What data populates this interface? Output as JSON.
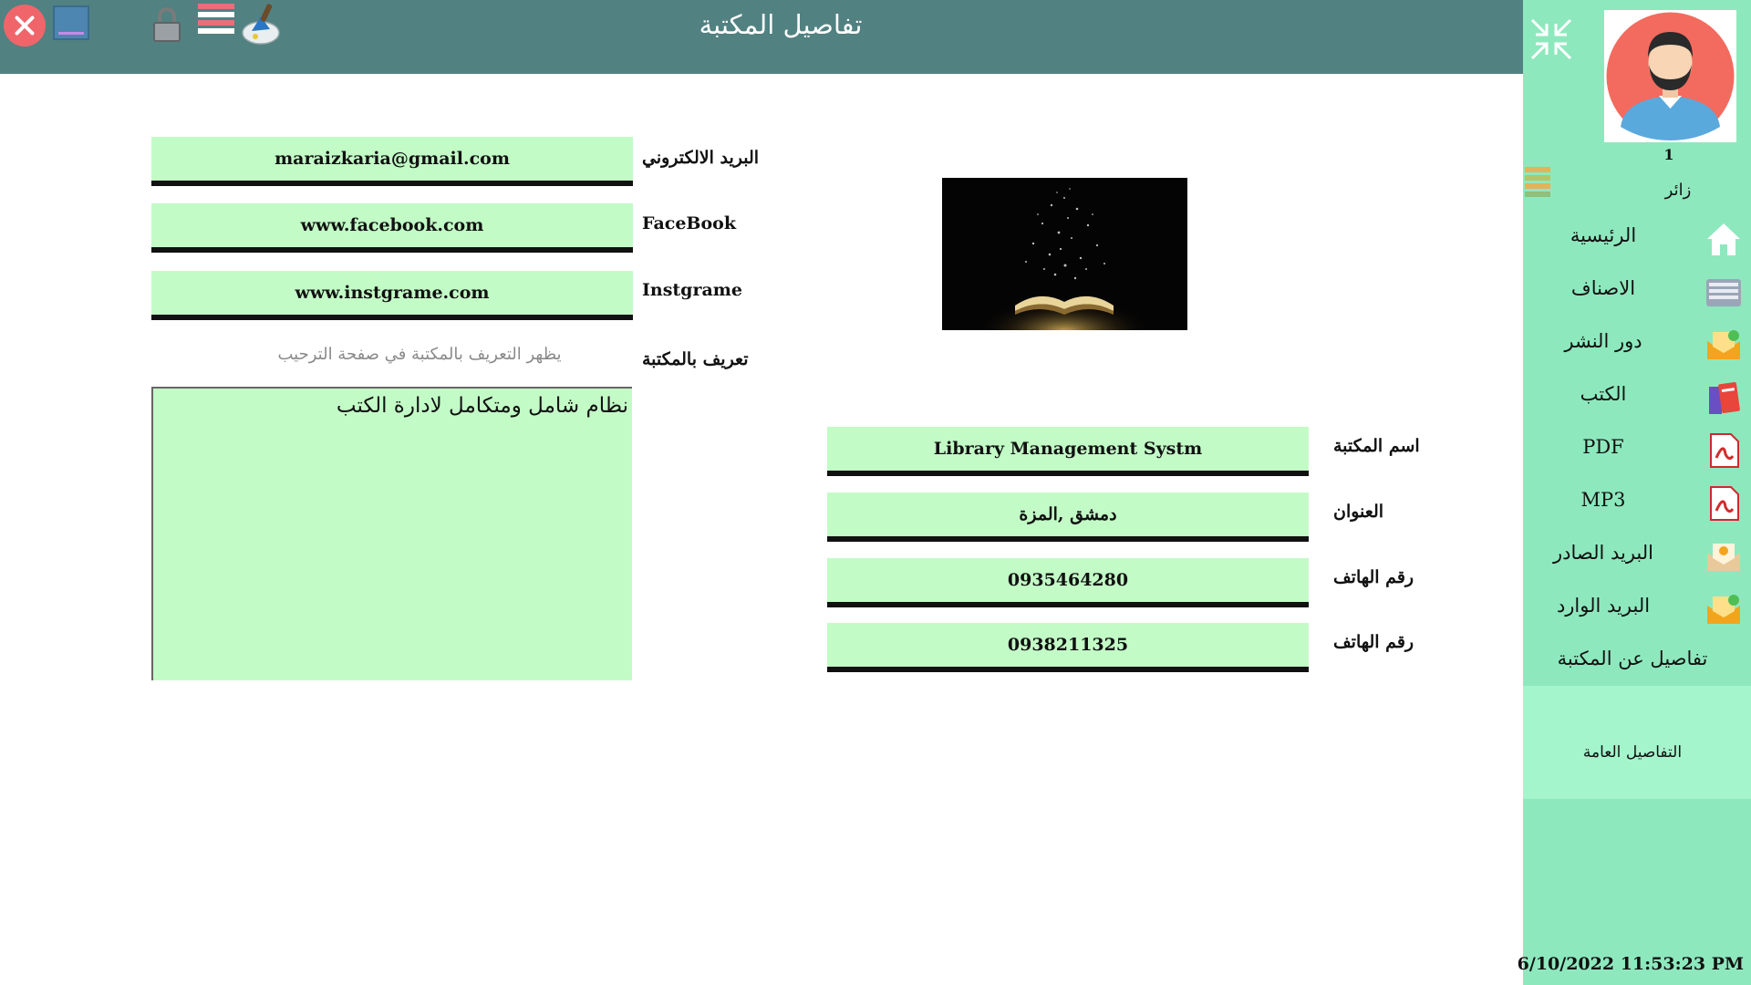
{
  "header": {
    "title": "تفاصيل المكتبة"
  },
  "toolbar": {
    "close_icon": "close-icon",
    "minimize_icon": "minimize-icon",
    "lock_icon": "lock-icon",
    "language_icon": "flag-icon",
    "theme_icon": "paint-icon"
  },
  "form_left": {
    "email": {
      "label": "البريد الالكتروني",
      "value": "maraizkaria@gmail.com"
    },
    "facebook": {
      "label": "FaceBook",
      "value": "www.facebook.com"
    },
    "instagram": {
      "label": "Instgrame",
      "value": "www.instgrame.com"
    },
    "description": {
      "label": "تعريف بالمكتبة",
      "hint": "يظهر التعريف بالمكتبة في صفحة الترحيب",
      "value": "نظام شامل ومتكامل لادارة الكتب"
    }
  },
  "form_right": {
    "library_name": {
      "label": "اسم المكتبة",
      "value": "Library Management Systm"
    },
    "address": {
      "label": "العنوان",
      "value": "دمشق ,المزة"
    },
    "phone1": {
      "label": "رقم الهاتف",
      "value": "0935464280"
    },
    "phone2": {
      "label": "رقم الهاتف",
      "value": "0938211325"
    }
  },
  "sidebar": {
    "user_number": "1",
    "user_role": "زائر",
    "items": [
      {
        "label": "الرئيسية",
        "icon": "home-icon"
      },
      {
        "label": "الاصناف",
        "icon": "categories-icon"
      },
      {
        "label": "دور النشر",
        "icon": "publishers-icon"
      },
      {
        "label": "الكتب",
        "icon": "books-icon"
      },
      {
        "label": "PDF",
        "icon": "pdf-icon"
      },
      {
        "label": "MP3",
        "icon": "mp3-icon"
      },
      {
        "label": "البريد الصادر",
        "icon": "outbox-icon"
      },
      {
        "label": "البريد الوارد",
        "icon": "inbox-icon"
      },
      {
        "label": "تفاصيل عن المكتبة"
      }
    ],
    "general_details": "التفاصيل العامة",
    "datetime": "6/10/2022 11:53:23 PM"
  },
  "colors": {
    "header": "#528181",
    "sidebar": "#8ee8be",
    "field": "#c3fbc7",
    "close": "#f0656a"
  }
}
